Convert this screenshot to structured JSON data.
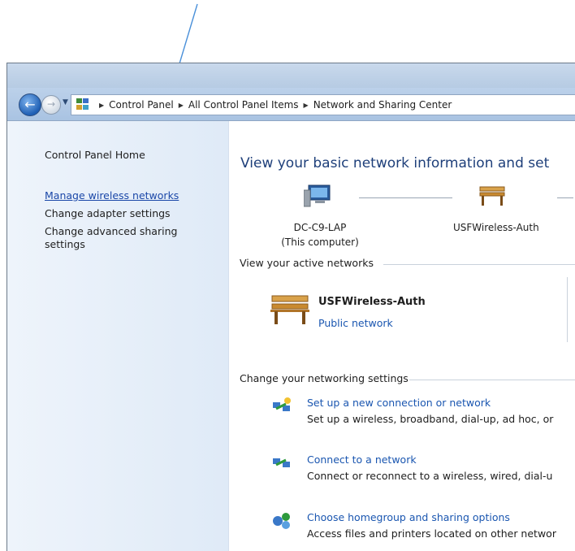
{
  "breadcrumb": [
    "Control Panel",
    "All Control Panel Items",
    "Network and Sharing Center"
  ],
  "sidebar": {
    "home": "Control Panel Home",
    "items": [
      {
        "label": "Manage wireless networks"
      },
      {
        "label": "Change adapter settings"
      },
      {
        "label": "Change advanced sharing settings"
      }
    ]
  },
  "main": {
    "title": "View your basic network information and set",
    "map": {
      "computer_name": "DC-C9-LAP",
      "computer_sub": "(This computer)",
      "network": "USFWireless-Auth"
    },
    "active_header": "View your active networks",
    "active_network": {
      "name": "USFWireless-Auth",
      "type": "Public network"
    },
    "settings_header": "Change your networking settings",
    "tasks": [
      {
        "link": "Set up a new connection or network",
        "desc": "Set up a wireless, broadband, dial-up, ad hoc, or"
      },
      {
        "link": "Connect to a network",
        "desc": "Connect or reconnect to a wireless, wired, dial-u"
      },
      {
        "link": "Choose homegroup and sharing options",
        "desc": "Access files and printers located on other networ"
      }
    ]
  },
  "colors": {
    "link": "#1a56b0",
    "title": "#1e3f7a",
    "arrow": "#4a90d9"
  }
}
